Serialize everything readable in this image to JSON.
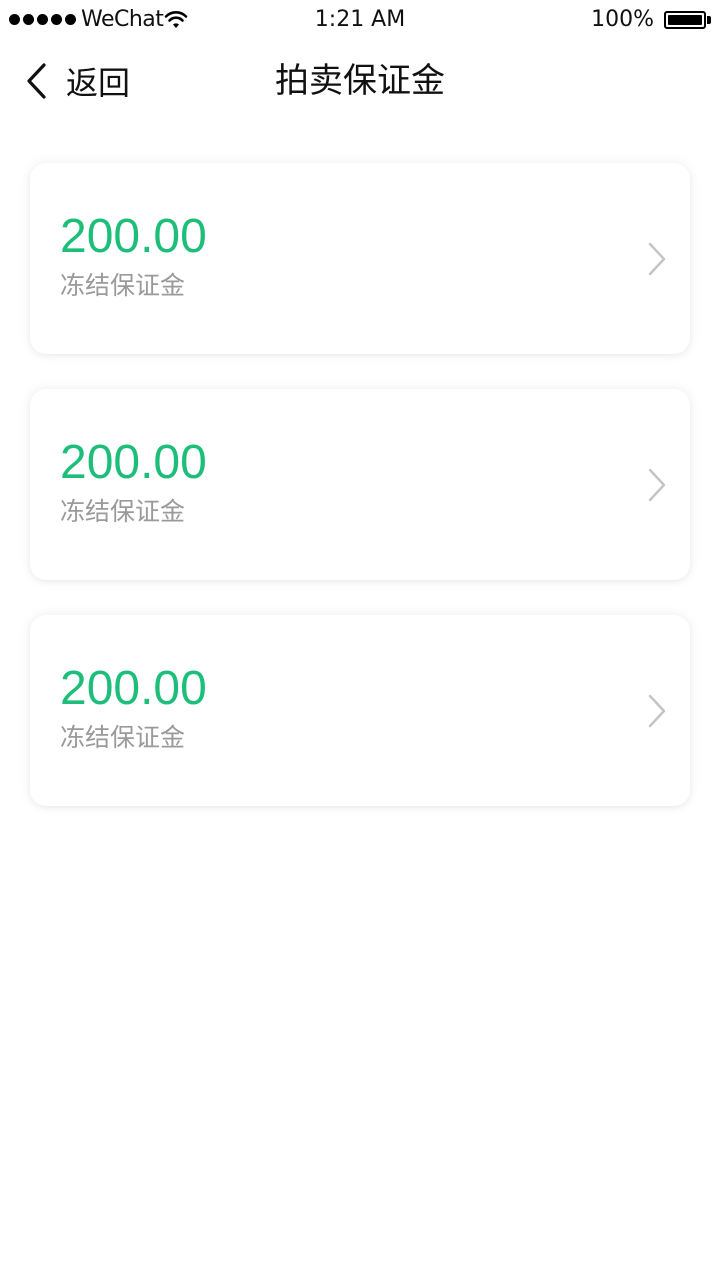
{
  "status_bar": {
    "carrier": "WeChat",
    "time": "1:21 AM",
    "battery": "100%",
    "icons": [
      "signal-icon",
      "wifi-icon",
      "battery-icon"
    ]
  },
  "nav": {
    "back_label": "返回",
    "title": "拍卖保证金",
    "back_icon": "chevron-left-icon"
  },
  "deposits": [
    {
      "amount": "200.00",
      "label": "冻结保证金",
      "icon": "chevron-right-icon"
    },
    {
      "amount": "200.00",
      "label": "冻结保证金",
      "icon": "chevron-right-icon"
    },
    {
      "amount": "200.00",
      "label": "冻结保证金",
      "icon": "chevron-right-icon"
    }
  ],
  "colors": {
    "accent": "#1dbe7a",
    "label": "#9a9a9a",
    "background": "#ffffff"
  }
}
